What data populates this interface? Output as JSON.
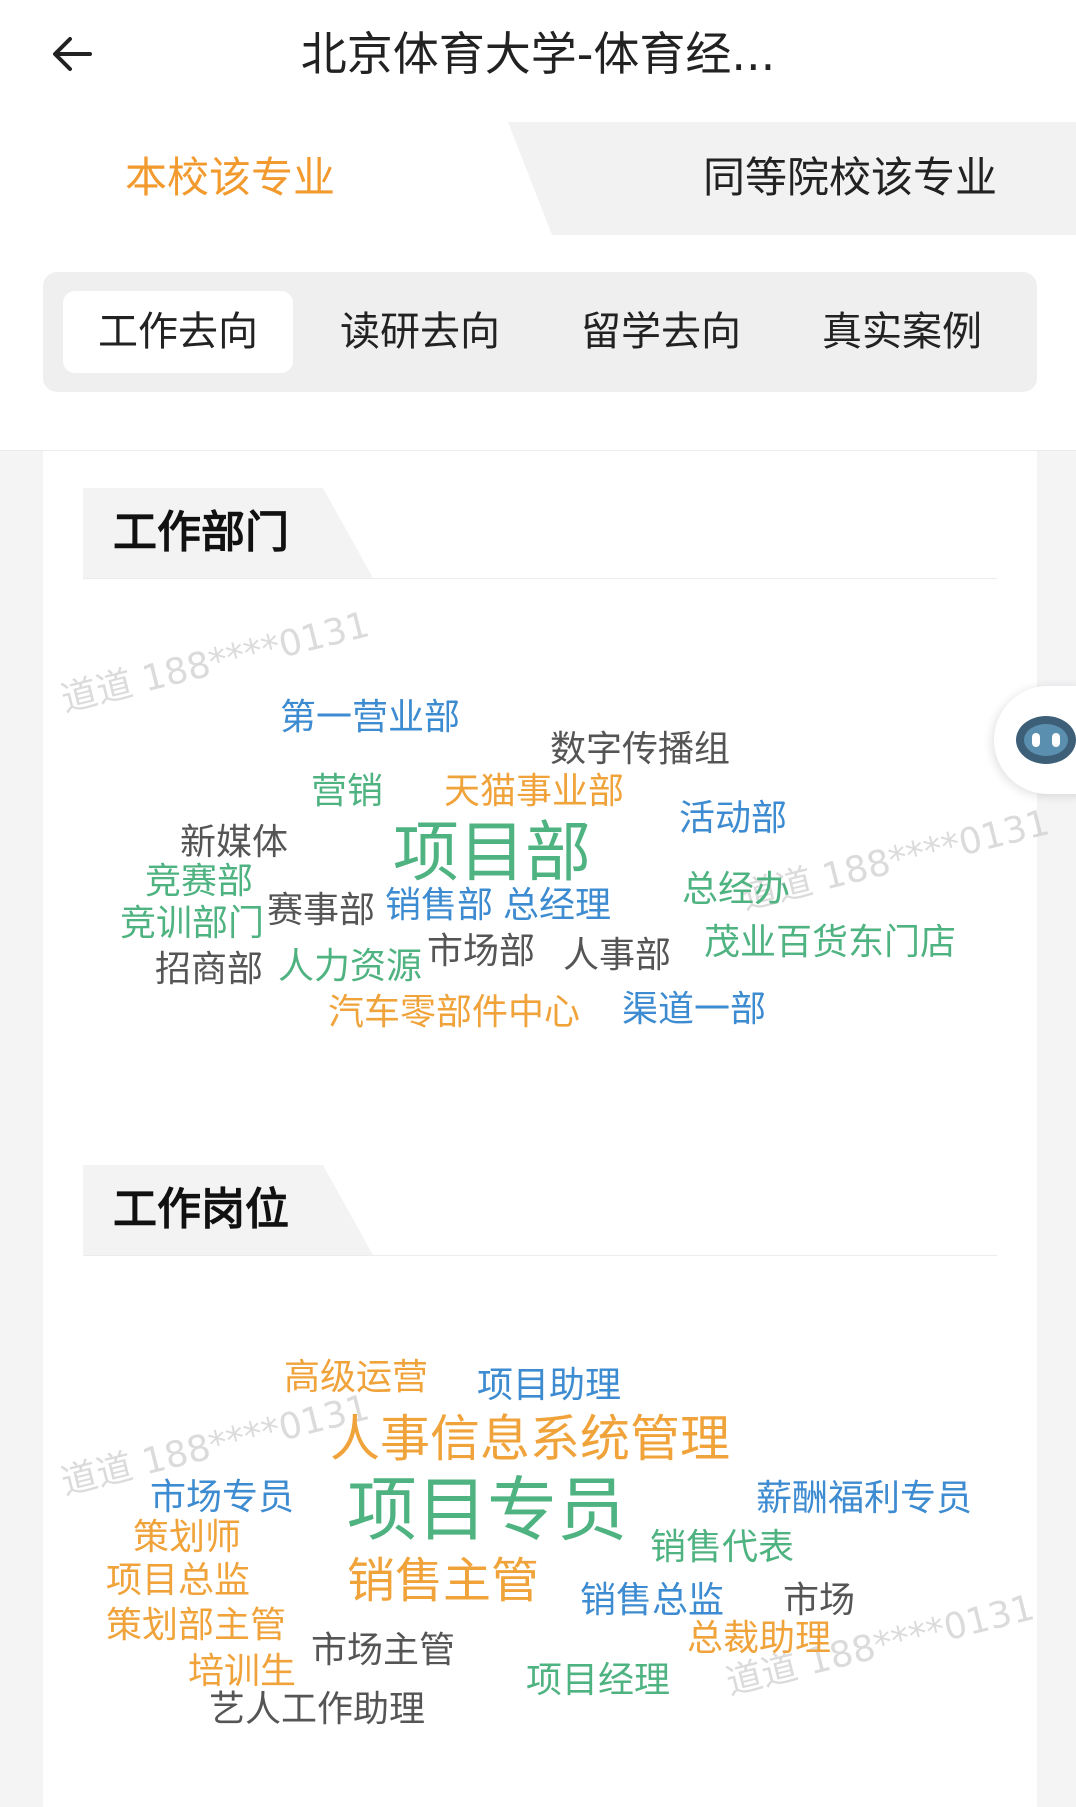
{
  "header": {
    "title": "北京体育大学-体育经..."
  },
  "segments": {
    "left": "本校该专业",
    "right": "同等院校该专业"
  },
  "tabs": [
    "工作去向",
    "读研去向",
    "留学去向",
    "真实案例"
  ],
  "watermark": "道道 188****0131",
  "sections": {
    "departments": {
      "title": "工作部门",
      "words": [
        "第一营业部",
        "数字传播组",
        "营销",
        "天猫事业部",
        "活动部",
        "新媒体",
        "项目部",
        "竞赛部",
        "总经办",
        "竞训部门",
        "赛事部",
        "销售部",
        "总经理",
        "茂业百货东门店",
        "招商部",
        "人力资源",
        "市场部",
        "人事部",
        "汽车零部件中心",
        "渠道一部"
      ]
    },
    "positions": {
      "title": "工作岗位",
      "words": [
        "高级运营",
        "项目助理",
        "人事信息系统管理",
        "市场专员",
        "项目专员",
        "薪酬福利专员",
        "策划师",
        "销售代表",
        "项目总监",
        "销售主管",
        "销售总监",
        "市场",
        "策划部主管",
        "总裁助理",
        "培训生",
        "市场主管",
        "项目经理",
        "艺人工作助理"
      ]
    }
  },
  "colors": {
    "accent": "#f29a2e",
    "cloud_blue": "#3d8bd0",
    "cloud_green": "#4fb381",
    "cloud_orange": "#f0a33a",
    "cloud_gray": "#555555"
  },
  "icons": {
    "back": "arrow-left-icon",
    "assistant": "robot-icon"
  }
}
